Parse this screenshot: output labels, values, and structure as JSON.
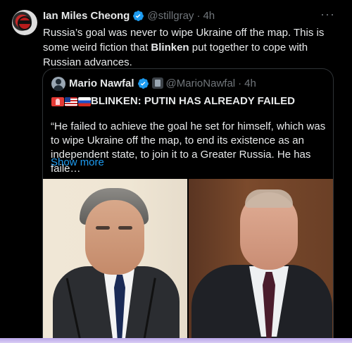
{
  "tweet": {
    "author_name": "Ian Miles Cheong",
    "handle": "@stillgray",
    "separator": "·",
    "time": "4h",
    "more_label": "···",
    "text_part1": "Russia’s goal was never to wipe Ukraine off the map. This is some weird fiction that ",
    "text_bold": "Blinken",
    "text_part2": " put together to cope with Russian advances."
  },
  "quote": {
    "author_name": "Mario Nawfal",
    "handle": "@MarioNawfal",
    "separator": "·",
    "time": "4h",
    "headline": "BLINKEN: PUTIN HAS ALREADY FAILED",
    "flags": [
      "alert-icon",
      "us-flag",
      "russia-flag"
    ],
    "text": "“He failed to achieve the goal he set for himself, which was to wipe Ukraine off the map, to end its existence as an independent state, to join it to a Greater Russia. He has faile…",
    "show_more": "Show more"
  },
  "colors": {
    "background": "#000000",
    "text": "#e7e9ea",
    "secondary": "#71767b",
    "link": "#1d9bf0",
    "verified": "#1d9bf0",
    "border": "#2f3336"
  }
}
